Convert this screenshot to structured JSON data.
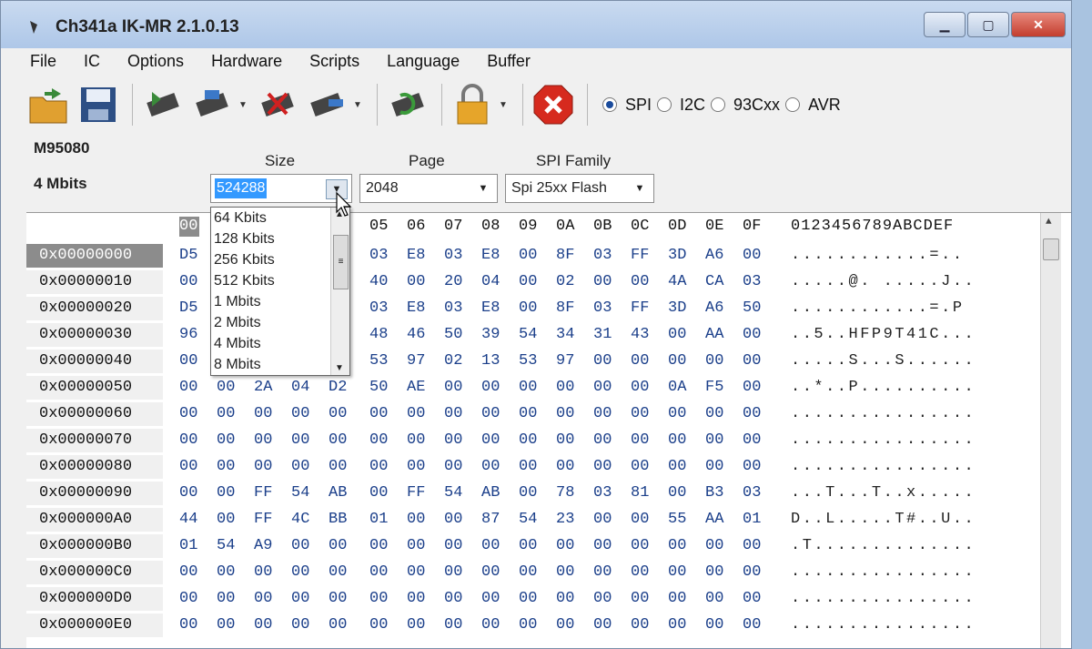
{
  "window": {
    "title": "Ch341a IK-MR 2.1.0.13"
  },
  "menu": [
    "File",
    "IC",
    "Options",
    "Hardware",
    "Scripts",
    "Language",
    "Buffer"
  ],
  "toolbar": {
    "icons": [
      "open-icon",
      "save-icon",
      "read-icon",
      "write-icon",
      "erase-icon",
      "verify-icon",
      "auto-icon",
      "lock-icon",
      "stop-icon"
    ],
    "protocols": [
      {
        "label": "SPI",
        "selected": true
      },
      {
        "label": "I2C",
        "selected": false
      },
      {
        "label": "93Cxx",
        "selected": false
      },
      {
        "label": "AVR",
        "selected": false
      }
    ]
  },
  "chip": {
    "name": "M95080",
    "size_text": "4 Mbits"
  },
  "labels": {
    "size": "Size",
    "page": "Page",
    "family": "SPI Family"
  },
  "size_combo": {
    "value": "524288"
  },
  "page_combo": {
    "value": "2048"
  },
  "family_combo": {
    "value": "Spi 25xx Flash"
  },
  "size_options": [
    "64 Kbits",
    "128 Kbits",
    "256 Kbits",
    "512 Kbits",
    "1 Mbits",
    "2 Mbits",
    "4 Mbits",
    "8 Mbits"
  ],
  "hex": {
    "header_cols": [
      "00",
      "05",
      "06",
      "07",
      "08",
      "09",
      "0A",
      "0B",
      "0C",
      "0D",
      "0E",
      "0F"
    ],
    "ascii_header": "0123456789ABCDEF",
    "rows": [
      {
        "addr": "0x00000000",
        "first": "D5",
        "vals": [
          "03",
          "E8",
          "03",
          "E8",
          "00",
          "8F",
          "03",
          "FF",
          "3D",
          "A6",
          "00"
        ],
        "ascii": "............=.."
      },
      {
        "addr": "0x00000010",
        "first": "00",
        "vals": [
          "40",
          "00",
          "20",
          "04",
          "00",
          "02",
          "00",
          "00",
          "4A",
          "CA",
          "03"
        ],
        "ascii": ".....@. .....J.."
      },
      {
        "addr": "0x00000020",
        "first": "D5",
        "vals": [
          "03",
          "E8",
          "03",
          "E8",
          "00",
          "8F",
          "03",
          "FF",
          "3D",
          "A6",
          "50"
        ],
        "ascii": "............=.P"
      },
      {
        "addr": "0x00000030",
        "first": "96",
        "vals": [
          "48",
          "46",
          "50",
          "39",
          "54",
          "34",
          "31",
          "43",
          "00",
          "AA",
          "00"
        ],
        "ascii": "..5..HFP9T41C..."
      },
      {
        "addr": "0x00000040",
        "first": "00",
        "vals": [
          "53",
          "97",
          "02",
          "13",
          "53",
          "97",
          "00",
          "00",
          "00",
          "00",
          "00"
        ],
        "ascii": ".....S...S......"
      },
      {
        "addr": "0x00000050",
        "first": "00",
        "vals": [
          "00",
          "2A",
          "04",
          "D2",
          "50",
          "AE",
          "00",
          "00",
          "00",
          "00",
          "00",
          "00",
          "0A",
          "F5",
          "00"
        ],
        "ascii": "..*..P.........."
      },
      {
        "addr": "0x00000060",
        "first": "00",
        "vals": [
          "00",
          "00",
          "00",
          "00",
          "00",
          "00",
          "00",
          "00",
          "00",
          "00",
          "00",
          "00",
          "00",
          "00",
          "00"
        ],
        "ascii": "................"
      },
      {
        "addr": "0x00000070",
        "first": "00",
        "vals": [
          "00",
          "00",
          "00",
          "00",
          "00",
          "00",
          "00",
          "00",
          "00",
          "00",
          "00",
          "00",
          "00",
          "00",
          "00"
        ],
        "ascii": "................"
      },
      {
        "addr": "0x00000080",
        "first": "00",
        "vals": [
          "00",
          "00",
          "00",
          "00",
          "00",
          "00",
          "00",
          "00",
          "00",
          "00",
          "00",
          "00",
          "00",
          "00",
          "00"
        ],
        "ascii": "................"
      },
      {
        "addr": "0x00000090",
        "first": "00",
        "vals": [
          "00",
          "FF",
          "54",
          "AB",
          "00",
          "FF",
          "54",
          "AB",
          "00",
          "78",
          "03",
          "81",
          "00",
          "B3",
          "03"
        ],
        "ascii": "...T...T..x....."
      },
      {
        "addr": "0x000000A0",
        "first": "44",
        "vals": [
          "00",
          "FF",
          "4C",
          "BB",
          "01",
          "00",
          "00",
          "87",
          "54",
          "23",
          "00",
          "00",
          "55",
          "AA",
          "01"
        ],
        "ascii": "D..L.....T#..U.."
      },
      {
        "addr": "0x000000B0",
        "first": "01",
        "vals": [
          "54",
          "A9",
          "00",
          "00",
          "00",
          "00",
          "00",
          "00",
          "00",
          "00",
          "00",
          "00",
          "00",
          "00",
          "00"
        ],
        "ascii": ".T.............."
      },
      {
        "addr": "0x000000C0",
        "first": "00",
        "vals": [
          "00",
          "00",
          "00",
          "00",
          "00",
          "00",
          "00",
          "00",
          "00",
          "00",
          "00",
          "00",
          "00",
          "00",
          "00"
        ],
        "ascii": "................"
      },
      {
        "addr": "0x000000D0",
        "first": "00",
        "vals": [
          "00",
          "00",
          "00",
          "00",
          "00",
          "00",
          "00",
          "00",
          "00",
          "00",
          "00",
          "00",
          "00",
          "00",
          "00"
        ],
        "ascii": "................"
      },
      {
        "addr": "0x000000E0",
        "first": "00",
        "vals": [
          "00",
          "00",
          "00",
          "00",
          "00",
          "00",
          "00",
          "00",
          "00",
          "00",
          "00",
          "00",
          "00",
          "00",
          "00"
        ],
        "ascii": "................"
      }
    ]
  }
}
